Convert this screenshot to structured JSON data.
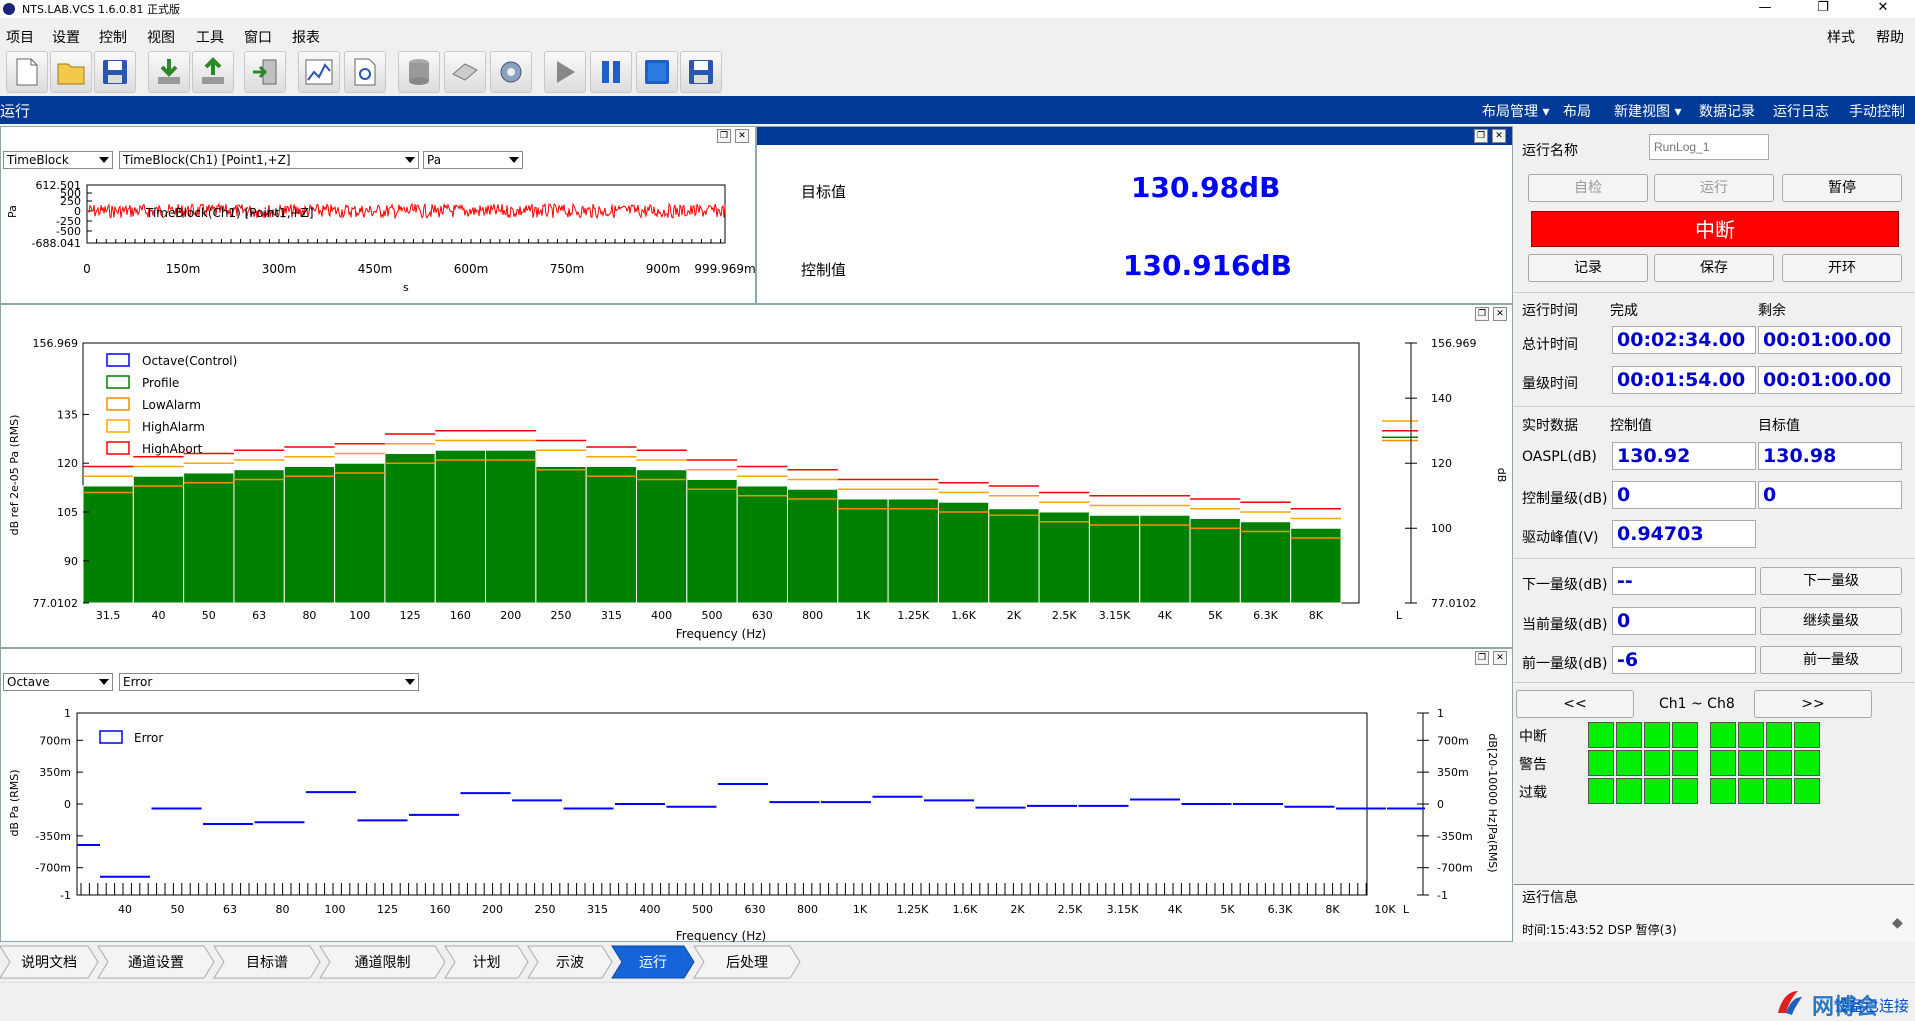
{
  "window": {
    "title": "NTS.LAB.VCS 1.6.0.81 正式版",
    "minimize": "—",
    "restore": "❐",
    "close": "✕"
  },
  "menu": {
    "items": [
      "项目",
      "设置",
      "控制",
      "视图",
      "工具",
      "窗口",
      "报表"
    ],
    "right": [
      "样式",
      "帮助"
    ]
  },
  "toolbar": {
    "icons": [
      "new-doc-icon",
      "open-folder-icon",
      "save-icon",
      "import-icon",
      "export-icon",
      "door-icon",
      "chart-icon",
      "settings-doc-icon",
      "database-icon",
      "eraser-icon",
      "gear-icon",
      "play-icon",
      "pause-icon",
      "stop-icon",
      "save-disk-icon"
    ]
  },
  "runbar": {
    "label": "运行",
    "items": [
      "布局管理 ▾",
      "布局",
      "新建视图 ▾",
      "数据记录",
      "运行日志",
      "手动控制"
    ]
  },
  "time_panel": {
    "sel1": "TimeBlock",
    "sel2": "TimeBlock(Ch1) [Point1,+Z]",
    "sel3": "Pa",
    "ylabel": "Pa",
    "xlabel": "s",
    "yticks": [
      "612.501",
      "500",
      "250",
      "0",
      "-250",
      "-500",
      "-688.041"
    ],
    "xticks": [
      "0",
      "150m",
      "300m",
      "450m",
      "600m",
      "750m",
      "900m",
      "999.969m"
    ],
    "legend": "TimeBlock(Ch1) [Point1,+Z]"
  },
  "value_panel": {
    "target_label": "目标值",
    "target_value": "130.98dB",
    "control_label": "控制值",
    "control_value": "130.916dB"
  },
  "chart_data": [
    {
      "type": "bar",
      "name": "octave-spectrum",
      "categories": [
        "31.5",
        "40",
        "50",
        "63",
        "80",
        "100",
        "125",
        "160",
        "200",
        "250",
        "315",
        "400",
        "500",
        "630",
        "800",
        "1K",
        "1.25K",
        "1.6K",
        "2K",
        "2.5K",
        "3.15K",
        "4K",
        "5K",
        "6.3K",
        "8K"
      ],
      "series": [
        {
          "name": "Octave(Control)",
          "values": [
            113,
            116,
            117,
            118,
            119,
            120,
            123,
            124,
            124,
            119,
            119,
            118,
            115,
            113,
            112,
            109,
            109,
            108,
            106,
            105,
            104,
            104,
            103,
            102,
            100
          ]
        },
        {
          "name": "Profile",
          "values": [
            113,
            116,
            117,
            118,
            119,
            120,
            123,
            124,
            124,
            119,
            119,
            118,
            115,
            113,
            112,
            109,
            109,
            108,
            106,
            105,
            104,
            104,
            103,
            102,
            100
          ]
        },
        {
          "name": "LowAlarm",
          "values": [
            111,
            113,
            114,
            115,
            116,
            117,
            120,
            121,
            121,
            118,
            116,
            115,
            112,
            110,
            109,
            106,
            106,
            105,
            104,
            102,
            101,
            101,
            100,
            99,
            97
          ]
        },
        {
          "name": "HighAlarm",
          "values": [
            116,
            119,
            120,
            121,
            122,
            123,
            126,
            127,
            127,
            124,
            122,
            121,
            118,
            116,
            115,
            112,
            112,
            111,
            110,
            108,
            107,
            107,
            106,
            105,
            103
          ]
        },
        {
          "name": "HighAbort",
          "values": [
            119,
            122,
            123,
            124,
            125,
            126,
            129,
            130,
            130,
            127,
            125,
            124,
            121,
            119,
            118,
            115,
            115,
            114,
            113,
            111,
            110,
            110,
            109,
            108,
            106
          ]
        }
      ],
      "right_marks": [
        130,
        133,
        128,
        127
      ],
      "yticks_left": [
        "156.969",
        "135",
        "120",
        "105",
        "90",
        "77.0102"
      ],
      "yticks_right": [
        "156.969",
        "140",
        "120",
        "100",
        "77.0102"
      ],
      "ylim": [
        77.0102,
        156.969
      ],
      "ylabel": "dB  ref 2e-05 Pa (RMS)",
      "ylabel_right": "dB",
      "xlabel": "Frequency (Hz)",
      "xend": "L",
      "colors": {
        "Octave(Control)": "#0000ff",
        "Profile": "#008000",
        "LowAlarm": "#ff8c00",
        "HighAlarm": "#ffa500",
        "HighAbort": "#ff0000"
      }
    },
    {
      "type": "line",
      "name": "error-spectrum",
      "categories": [
        "40",
        "50",
        "63",
        "80",
        "100",
        "125",
        "160",
        "200",
        "250",
        "315",
        "400",
        "500",
        "630",
        "800",
        "1K",
        "1.25K",
        "1.6K",
        "2K",
        "2.5K",
        "3.15K",
        "4K",
        "5K",
        "6.3K",
        "8K",
        "10K"
      ],
      "series": [
        {
          "name": "Error",
          "values": [
            -0.8,
            -0.05,
            -0.22,
            -0.2,
            0.13,
            -0.18,
            -0.12,
            0.12,
            0.04,
            -0.05,
            0.0,
            -0.03,
            0.22,
            0.02,
            0.02,
            0.08,
            0.04,
            -0.04,
            -0.02,
            -0.02,
            0.05,
            0.0,
            0.0,
            -0.03,
            -0.05
          ]
        }
      ],
      "left_start": -0.45,
      "yticks": [
        "1",
        "700m",
        "350m",
        "0",
        "-350m",
        "-700m",
        "-1"
      ],
      "ylim": [
        -1,
        1
      ],
      "ylabel": "dB Pa (RMS)",
      "ylabel_right": "dB[20-10000 Hz]Pa(RMS)",
      "xlabel": "Frequency (Hz)",
      "xend": "L",
      "sel1": "Octave",
      "sel2": "Error"
    }
  ],
  "right": {
    "run_name_label": "运行名称",
    "run_name_placeholder": "RunLog_1",
    "btn_selfcheck": "自检",
    "btn_run": "运行",
    "btn_pause": "暂停",
    "status": "中断",
    "btn_record": "记录",
    "btn_save": "保存",
    "btn_openloop": "开环",
    "runtime_label": "运行时间",
    "done_label": "完成",
    "remain_label": "剩余",
    "total_label": "总计时间",
    "total_done": "00:02:34.00",
    "total_remain": "00:01:00.00",
    "level_label": "量级时间",
    "level_done": "00:01:54.00",
    "level_remain": "00:01:00.00",
    "realtime_label": "实时数据",
    "control_label": "控制值",
    "target_label": "目标值",
    "oaspl_label": "OASPL(dB)",
    "oaspl_control": "130.92",
    "oaspl_target": "130.98",
    "ctrllevel_label": "控制量级(dB)",
    "ctrllevel_control": "0",
    "ctrllevel_target": "0",
    "drive_label": "驱动峰值(V)",
    "drive_value": "0.94703",
    "next_label": "下一量级(dB)",
    "next_value": "--",
    "next_btn": "下一量级",
    "cur_label": "当前量级(dB)",
    "cur_value": "0",
    "cur_btn": "继续量级",
    "prev_label": "前一量级(dB)",
    "prev_value": "-6",
    "prev_btn": "前一量级",
    "ch_prev": "<<",
    "ch_range": "Ch1 ~ Ch8",
    "ch_next": ">>",
    "led_rows": [
      "中断",
      "警告",
      "过载"
    ],
    "info_title": "运行信息",
    "info_line1": "时间:15:43:52 DSP 暂停(3)"
  },
  "nav": {
    "tabs": [
      "说明文档",
      "通道设置",
      "目标谱",
      "通道限制",
      "计划",
      "示波",
      "运行",
      "后处理"
    ],
    "active": 6
  },
  "status": {
    "connected": "设备已连接",
    "brand": "网博会"
  }
}
